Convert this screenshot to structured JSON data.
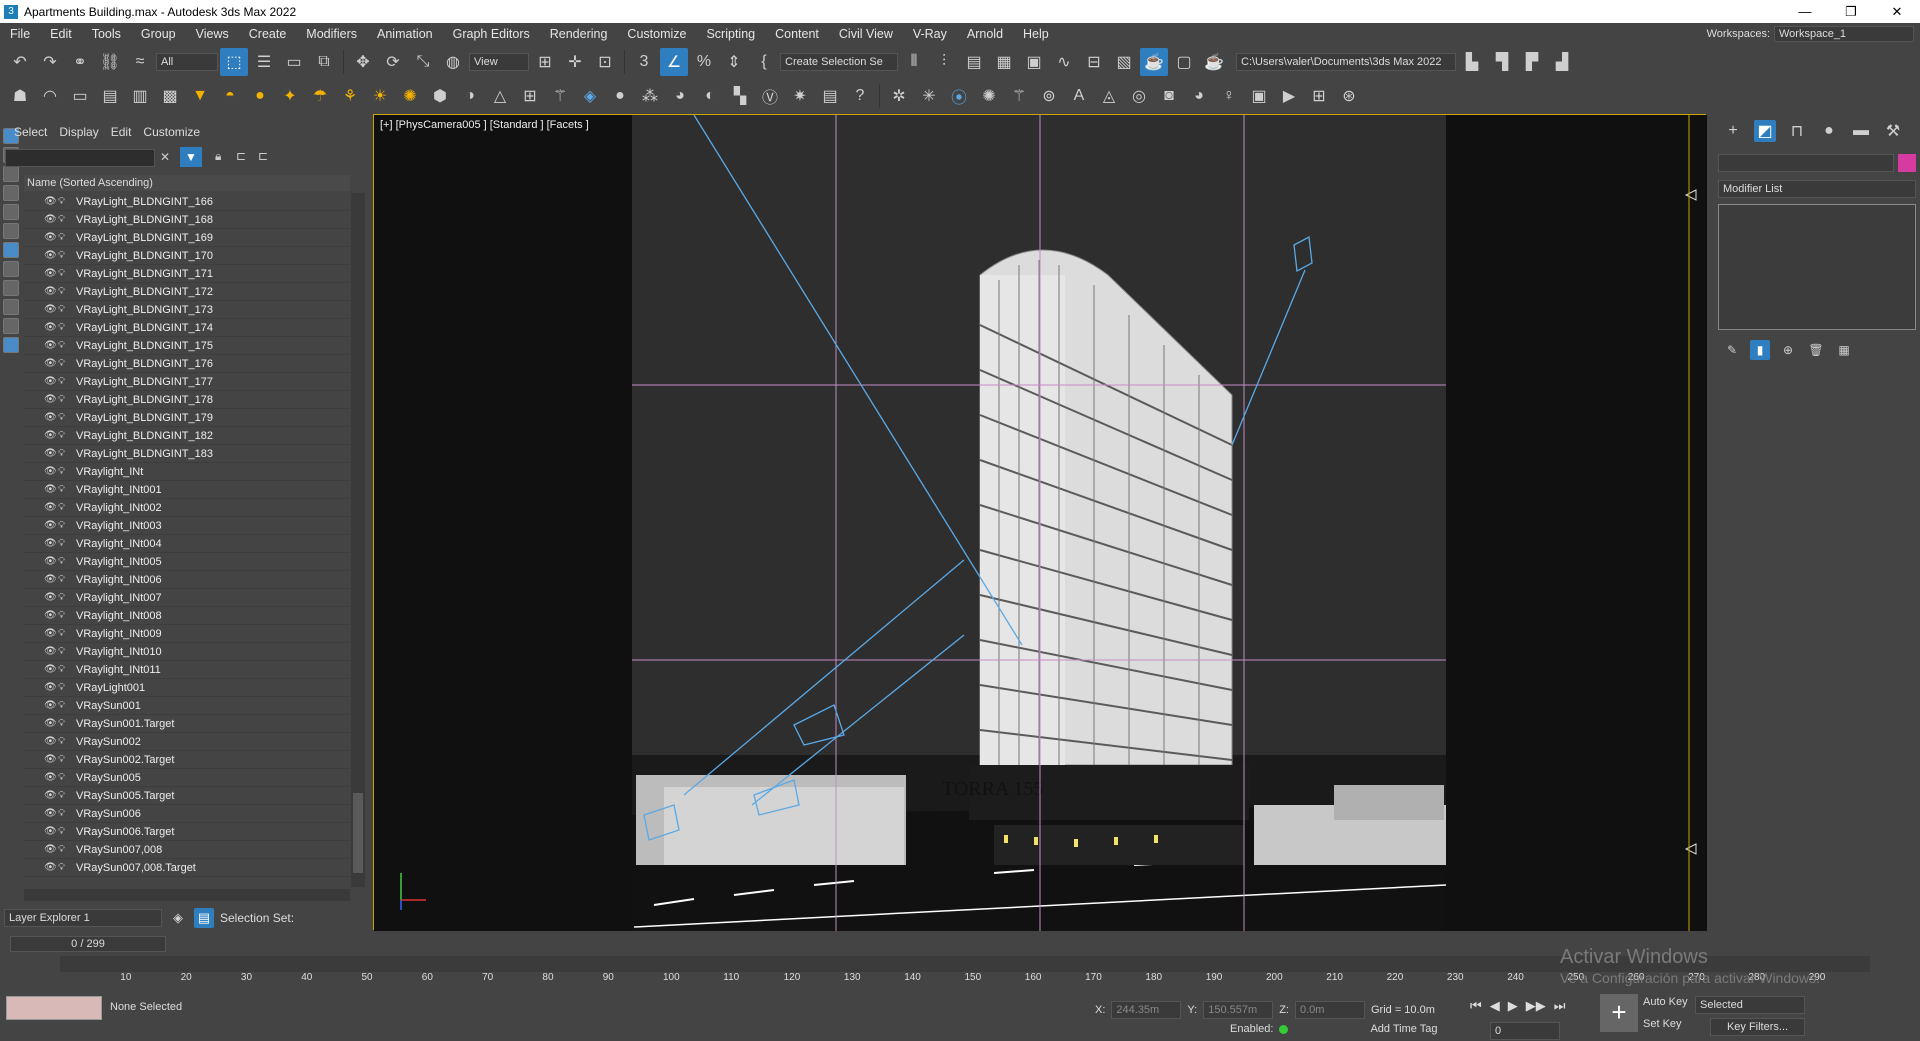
{
  "window": {
    "title": "Apartments Building.max - Autodesk 3ds Max 2022",
    "min": "—",
    "max": "❐",
    "close": "✕"
  },
  "menu": [
    "File",
    "Edit",
    "Tools",
    "Group",
    "Views",
    "Create",
    "Modifiers",
    "Animation",
    "Graph Editors",
    "Rendering",
    "Customize",
    "Scripting",
    "Content",
    "Civil View",
    "V-Ray",
    "Arnold",
    "Help"
  ],
  "workspace": {
    "label": "Workspaces:",
    "value": "Workspace_1"
  },
  "toolbar": {
    "filter": "All",
    "ref_coord": "View",
    "selection_set": "Create Selection Se",
    "path": "C:\\Users\\valer\\Documents\\3ds Max 2022"
  },
  "explorer": {
    "menu": [
      "Select",
      "Display",
      "Edit",
      "Customize"
    ],
    "column_header": "Name (Sorted Ascending)",
    "rows": [
      "VRayLight_BLDNGINT_166",
      "VRayLight_BLDNGINT_168",
      "VRayLight_BLDNGINT_169",
      "VRayLight_BLDNGINT_170",
      "VRayLight_BLDNGINT_171",
      "VRayLight_BLDNGINT_172",
      "VRayLight_BLDNGINT_173",
      "VRayLight_BLDNGINT_174",
      "VRayLight_BLDNGINT_175",
      "VRayLight_BLDNGINT_176",
      "VRayLight_BLDNGINT_177",
      "VRayLight_BLDNGINT_178",
      "VRayLight_BLDNGINT_179",
      "VRayLight_BLDNGINT_182",
      "VRayLight_BLDNGINT_183",
      "VRaylight_INt",
      "VRaylight_INt001",
      "VRaylight_INt002",
      "VRaylight_INt003",
      "VRaylight_INt004",
      "VRaylight_INt005",
      "VRaylight_INt006",
      "VRaylight_INt007",
      "VRaylight_INt008",
      "VRaylight_INt009",
      "VRaylight_INt010",
      "VRaylight_INt011",
      "VRayLight001",
      "VRaySun001",
      "VRaySun001.Target",
      "VRaySun002",
      "VRaySun002.Target",
      "VRaySun005",
      "VRaySun005.Target",
      "VRaySun006",
      "VRaySun006.Target",
      "VRaySun007,008",
      "VRaySun007,008.Target"
    ],
    "layer_explorer": "Layer Explorer 1",
    "selection_set_label": "Selection Set:"
  },
  "viewport": {
    "label": "[+] [PhysCamera005 ] [Standard ] [Facets ]",
    "sign": "TORRA 155"
  },
  "command_panel": {
    "modifier_list": "Modifier List"
  },
  "timeline": {
    "frame": "0 / 299",
    "ticks": [
      "10",
      "20",
      "30",
      "40",
      "50",
      "60",
      "70",
      "80",
      "90",
      "100",
      "110",
      "120",
      "130",
      "140",
      "150",
      "160",
      "170",
      "180",
      "190",
      "200",
      "210",
      "220",
      "230",
      "240",
      "250",
      "260",
      "270",
      "280",
      "290"
    ]
  },
  "status": {
    "selection": "None Selected",
    "x_label": "X:",
    "x": "244.35m",
    "y_label": "Y:",
    "y": "150.557m",
    "z_label": "Z:",
    "z": "0.0m",
    "grid": "Grid = 10.0m",
    "enabled": "Enabled:",
    "add_time_tag": "Add Time Tag",
    "auto_key": "Auto Key",
    "set_key": "Set Key",
    "key_mode": "Selected",
    "key_filters": "Key Filters...",
    "frame_field": "0",
    "watermark1": "Activar Windows",
    "watermark2": "Ve a Configuración para activar Windows."
  }
}
